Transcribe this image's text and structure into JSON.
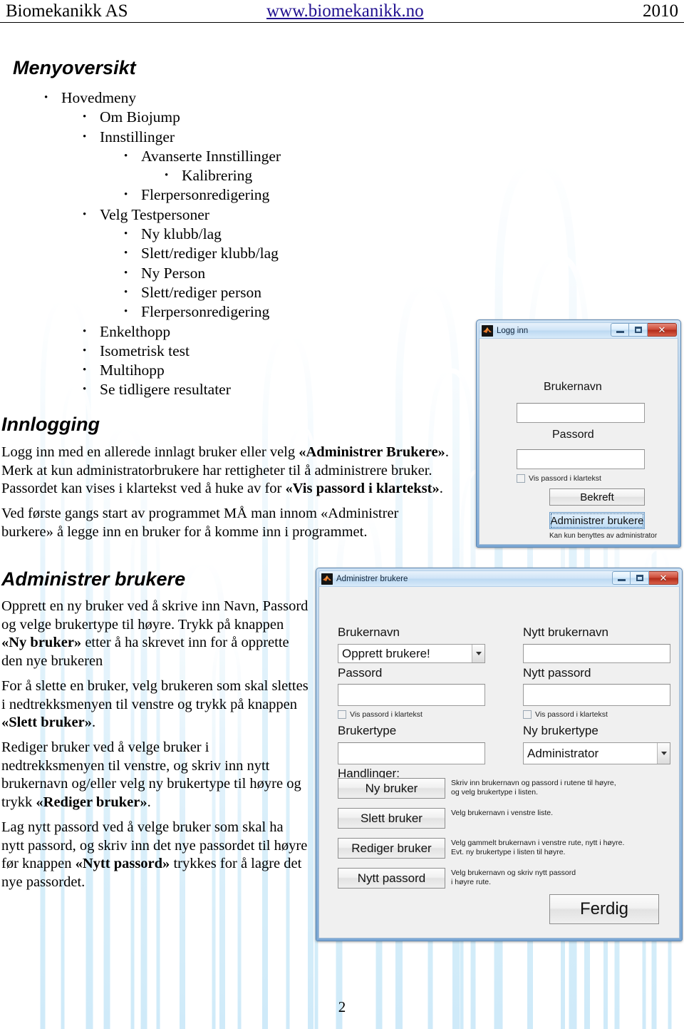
{
  "header": {
    "company": "Biomekanikk AS",
    "website": "www.biomekanikk.no",
    "year": "2010"
  },
  "page_number": "2",
  "sections": {
    "menu_heading": "Menyoversikt",
    "login_heading": "Innlogging",
    "admin_heading": "Administrer brukere"
  },
  "menu_outline": [
    {
      "label": "Hovedmeny",
      "level": 1
    },
    {
      "label": "Om Biojump",
      "level": 2
    },
    {
      "label": "Innstillinger",
      "level": 2
    },
    {
      "label": "Avanserte Innstillinger",
      "level": 3
    },
    {
      "label": "Kalibrering",
      "level": 4
    },
    {
      "label": "Flerpersonredigering",
      "level": 3
    },
    {
      "label": "Velg Testpersoner",
      "level": 2
    },
    {
      "label": "Ny klubb/lag",
      "level": 3
    },
    {
      "label": "Slett/rediger klubb/lag",
      "level": 3
    },
    {
      "label": "Ny Person",
      "level": 3
    },
    {
      "label": "Slett/rediger person",
      "level": 3
    },
    {
      "label": "Flerpersonredigering",
      "level": 3
    },
    {
      "label": "Enkelthopp",
      "level": 2
    },
    {
      "label": "Isometrisk test",
      "level": 2
    },
    {
      "label": "Multihopp",
      "level": 2
    },
    {
      "label": "Se tidligere resultater",
      "level": 2
    }
  ],
  "login_text": {
    "p1_a": "Logg inn med en allerede innlagt bruker eller velg ",
    "p1_b": "«Administrer Brukere»",
    "p1_c": ". Merk at kun administratorbrukere har rettigheter til å administrere bruker. Passordet kan vises i klartekst ved å huke av for ",
    "p1_d": "«Vis passord i klartekst»",
    "p1_e": ".",
    "p2": "Ved første gangs start av programmet MÅ man innom «Administrer burkere» å legge inn en bruker for å komme inn i programmet."
  },
  "admin_text": {
    "p1_a": "Opprett en ny bruker ved å skrive inn Navn, Passord og velge brukertype til høyre. Trykk på knappen ",
    "p1_b": "«Ny bruker»",
    "p1_c": " etter å ha skrevet inn for å opprette den nye brukeren",
    "p2_a": "For å slette en bruker, velg brukeren som skal slettes i nedtrekksmenyen til venstre og trykk på knappen ",
    "p2_b": "«Slett bruker»",
    "p2_c": ".",
    "p3_a": "Rediger bruker ved å velge bruker i nedtrekksmenyen til venstre, og skriv inn nytt brukernavn og/eller velg ny brukertype til høyre og trykk ",
    "p3_b": "«Rediger bruker»",
    "p3_c": ".",
    "p4_a": "Lag nytt passord ved å velge bruker som skal ha nytt passord, og skriv inn det nye passordet til høyre før knappen ",
    "p4_b": "«Nytt passord»",
    "p4_c": " trykkes for å lagre det nye passordet."
  },
  "login_dialog": {
    "title": "Logg inn",
    "icon": "matlab-icon",
    "minimize_icon": "minimize-icon",
    "maximize_icon": "maximize-icon",
    "close_icon": "close-icon",
    "close_label": "✕",
    "username_label": "Brukernavn",
    "username_value": "",
    "password_label": "Passord",
    "password_value": "",
    "show_password_label": "Vis passord i klartekst",
    "confirm_button": "Bekreft",
    "admin_button": "Administrer brukere",
    "admin_note": "Kan kun benyttes av administrator"
  },
  "admin_dialog": {
    "title": "Administrer brukere",
    "icon": "matlab-icon",
    "minimize_icon": "minimize-icon",
    "maximize_icon": "maximize-icon",
    "close_icon": "close-icon",
    "close_label": "✕",
    "left": {
      "username_label": "Brukernavn",
      "username_selected": "Opprett brukere!",
      "password_label": "Passord",
      "password_value": "",
      "show_password_label": "Vis passord i klartekst",
      "usertype_label": "Brukertype",
      "usertype_value": "",
      "actions_label": "Handlinger:"
    },
    "right": {
      "new_username_label": "Nytt brukernavn",
      "new_username_value": "",
      "new_password_label": "Nytt passord",
      "new_password_value": "",
      "show_password_label": "Vis passord i klartekst",
      "new_usertype_label": "Ny brukertype",
      "new_usertype_selected": "Administrator"
    },
    "actions": [
      {
        "button": "Ny bruker",
        "hint_line1": "Skriv inn brukernavn og passord i rutene til høyre,",
        "hint_line2": "og velg brukertype i listen."
      },
      {
        "button": "Slett bruker",
        "hint_line1": "Velg brukernavn i venstre liste.",
        "hint_line2": ""
      },
      {
        "button": "Rediger bruker",
        "hint_line1": "Velg gammelt brukernavn i venstre rute, nytt i høyre.",
        "hint_line2": "Evt. ny brukertype i listen til høyre."
      },
      {
        "button": "Nytt passord",
        "hint_line1": "Velg brukernavn og skriv nytt passord",
        "hint_line2": "i høyre rute."
      }
    ],
    "done_button": "Ferdig"
  }
}
